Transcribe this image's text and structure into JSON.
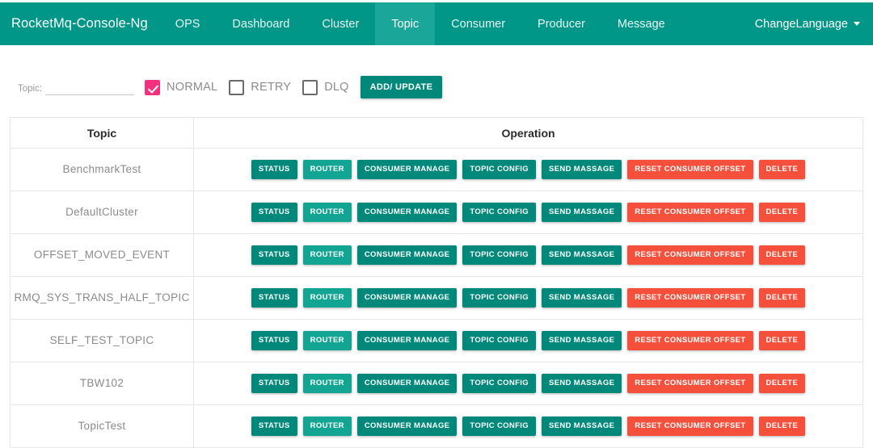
{
  "navbar": {
    "brand": "RocketMq-Console-Ng",
    "items": [
      {
        "label": "OPS",
        "active": false
      },
      {
        "label": "Dashboard",
        "active": false
      },
      {
        "label": "Cluster",
        "active": false
      },
      {
        "label": "Topic",
        "active": true
      },
      {
        "label": "Consumer",
        "active": false
      },
      {
        "label": "Producer",
        "active": false
      },
      {
        "label": "Message",
        "active": false
      }
    ],
    "language_label": "ChangeLanguage",
    "language_caret_icon": "chevron-down-icon"
  },
  "filter": {
    "topic_label": "Topic:",
    "topic_value": "",
    "topic_placeholder": "",
    "checkboxes": [
      {
        "label": "NORMAL",
        "checked": true
      },
      {
        "label": "RETRY",
        "checked": false
      },
      {
        "label": "DLQ",
        "checked": false
      }
    ],
    "add_update_label": "ADD/ UPDATE"
  },
  "table": {
    "headers": {
      "topic": "Topic",
      "operation": "Operation"
    },
    "operation_buttons": [
      {
        "label": "STATUS",
        "style": "teal"
      },
      {
        "label": "ROUTER",
        "style": "teal-light"
      },
      {
        "label": "CONSUMER MANAGE",
        "style": "teal"
      },
      {
        "label": "TOPIC CONFIG",
        "style": "teal"
      },
      {
        "label": "SEND MASSAGE",
        "style": "teal"
      },
      {
        "label": "RESET CONSUMER OFFSET",
        "style": "red"
      },
      {
        "label": "DELETE",
        "style": "red"
      }
    ],
    "rows": [
      {
        "topic": "BenchmarkTest"
      },
      {
        "topic": "DefaultCluster"
      },
      {
        "topic": "OFFSET_MOVED_EVENT"
      },
      {
        "topic": "RMQ_SYS_TRANS_HALF_TOPIC"
      },
      {
        "topic": "SELF_TEST_TOPIC"
      },
      {
        "topic": "TBW102"
      },
      {
        "topic": "TopicTest"
      }
    ]
  },
  "colors": {
    "navbar_teal": "#009688",
    "active_tab_teal": "#1AA79A",
    "button_teal": "#00897B",
    "button_teal_light": "#12A594",
    "button_red": "#F4503C",
    "checkbox_pink": "#F5317F"
  }
}
